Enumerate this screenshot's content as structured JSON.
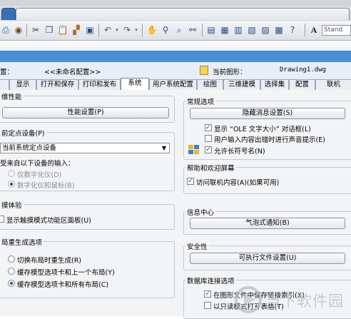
{
  "toolbar": {
    "style_label": "Stand"
  },
  "header": {
    "saved_profile_label": "置：",
    "saved_profile_value": "<<未命名配置>>",
    "current_drawing_label": "当前图形：",
    "current_drawing_value": "Drawing1.dwg"
  },
  "tabs": [
    {
      "label": "显示"
    },
    {
      "label": "打开和保存"
    },
    {
      "label": "打印和发布"
    },
    {
      "label": "系统"
    },
    {
      "label": "用户系统配置"
    },
    {
      "label": "绘图"
    },
    {
      "label": "三维建模"
    },
    {
      "label": "选择集"
    },
    {
      "label": "配置"
    },
    {
      "label": "联机"
    }
  ],
  "left": {
    "perf_title": "维性能",
    "perf_button": "性能设置(P)",
    "pointing_title": "前定点设备(P)",
    "pointing_value": "当前系统定点设备",
    "accept_label": "受来自以下设备的输入：",
    "digitizer_only": "仅数字化仪(D)",
    "digitizer_mouse": "数字化仪和鼠标(B)",
    "touch_title": "摸体验",
    "touch_ribbon": "显示触摸模式功能区面板(U)",
    "regen_title": "局重生成选项",
    "regen_opt1": "切换布局时重生成(R)",
    "regen_opt2": "缓存模型选项卡和上一个布局(Y)",
    "regen_opt3": "缓存模型选项卡和所有布局(C)"
  },
  "right": {
    "general_title": "常规选项",
    "hide_msgs_button": "隐藏消息设置(S)",
    "show_ole": "显示 “OLE 文字大小” 对话框(L)",
    "beep": "用户输入内容出错时进行声音提示(E)",
    "long_names": "允许长符号名(N)",
    "help_title": "帮助和欢迎屏幕",
    "online_help": "访问联机内容(A)(如果可用)",
    "info_title": "信息中心",
    "balloon_button": "气泡式通知(B)",
    "security_title": "安全性",
    "exec_button": "可执行文件设置(U)",
    "db_title": "数据库连接选项",
    "db_index": "在图形文件中保存链接索引(X)",
    "db_readonly": "以只读模式打开表格(T)"
  },
  "states": {
    "show_ole": true,
    "beep": false,
    "long_names": true,
    "online_help": true,
    "touch_ribbon": false,
    "db_index": true,
    "db_readonly": false,
    "regen_selected": 3
  },
  "watermark": {
    "text": "当下软件园",
    "colors": [
      "#b9bdc3",
      "#d3d6da"
    ]
  }
}
